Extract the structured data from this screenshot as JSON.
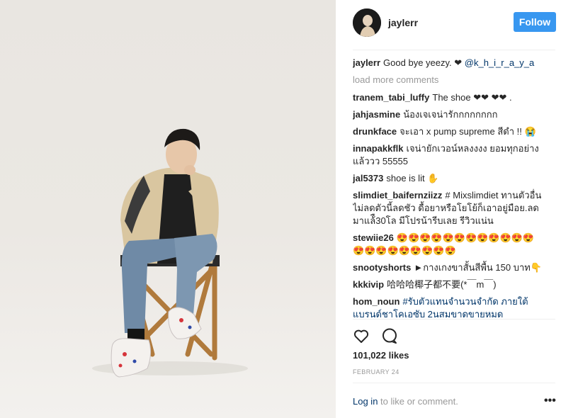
{
  "post": {
    "username": "jaylerr",
    "follow_label": "Follow",
    "caption_text": "Good bye yeezy. ❤ ",
    "caption_mention": "@k_h_i_r_a_y_a",
    "load_more": "load more comments",
    "comments": [
      {
        "user": "tranem_tabi_luffy",
        "text": "The shoe ❤❤ ❤❤ ."
      },
      {
        "user": "jahjasmine",
        "text": "น้องเจเจน่ารักกกกกกกก"
      },
      {
        "user": "drunkface",
        "text": "จะเอา x pump supreme สีดำ !! 😭"
      },
      {
        "user": "innapakkflk",
        "text": "เจน่ายักเวอน์หลงงงง ยอมทุกอย่างแล้ววว 55555"
      },
      {
        "user": "jal5373",
        "text": "shoe is lit ✋"
      },
      {
        "user": "slimdiet_baifernziizz",
        "text": "# Mixslimdiet ทานตัวอื่นไม่ลดตัวนี้ลดชัว ดื้อยาหรือโยโย้ก็เอาอยู่มือย.ลดมาแล้ื30โล มีโปรน้ารีบเลย รีวิวแน่น"
      },
      {
        "user": "stewiie26",
        "text": "😍😍😍😍😍😍😍😍😍😍😍😍😍😍😍😍😍😍😍😍😍"
      },
      {
        "user": "snootyshorts",
        "text": "►กางเกงขาสั้นสีพื้น 150 บาท👇"
      },
      {
        "user": "kkkivip",
        "text": "哈哈哈椰子都不要(*￣m￣)"
      },
      {
        "user": "hom_noun",
        "text": "#รับตัวแทนจำนวนจำกัด ภายใต้แบรนด์ชาโคเอซับ 2นสมขาดขายหมด"
      }
    ],
    "likes": "101,022 likes",
    "date": "FEBRUARY 24",
    "login_link": "Log in",
    "login_rest": " to like or comment.",
    "more_options": "•••"
  },
  "icons": {
    "like": "heart-outline-icon",
    "comment": "speech-bubble-icon",
    "options": "ellipsis-icon"
  },
  "colors": {
    "accent": "#3897f0",
    "link": "#003569",
    "muted": "#999999",
    "text": "#262626"
  }
}
